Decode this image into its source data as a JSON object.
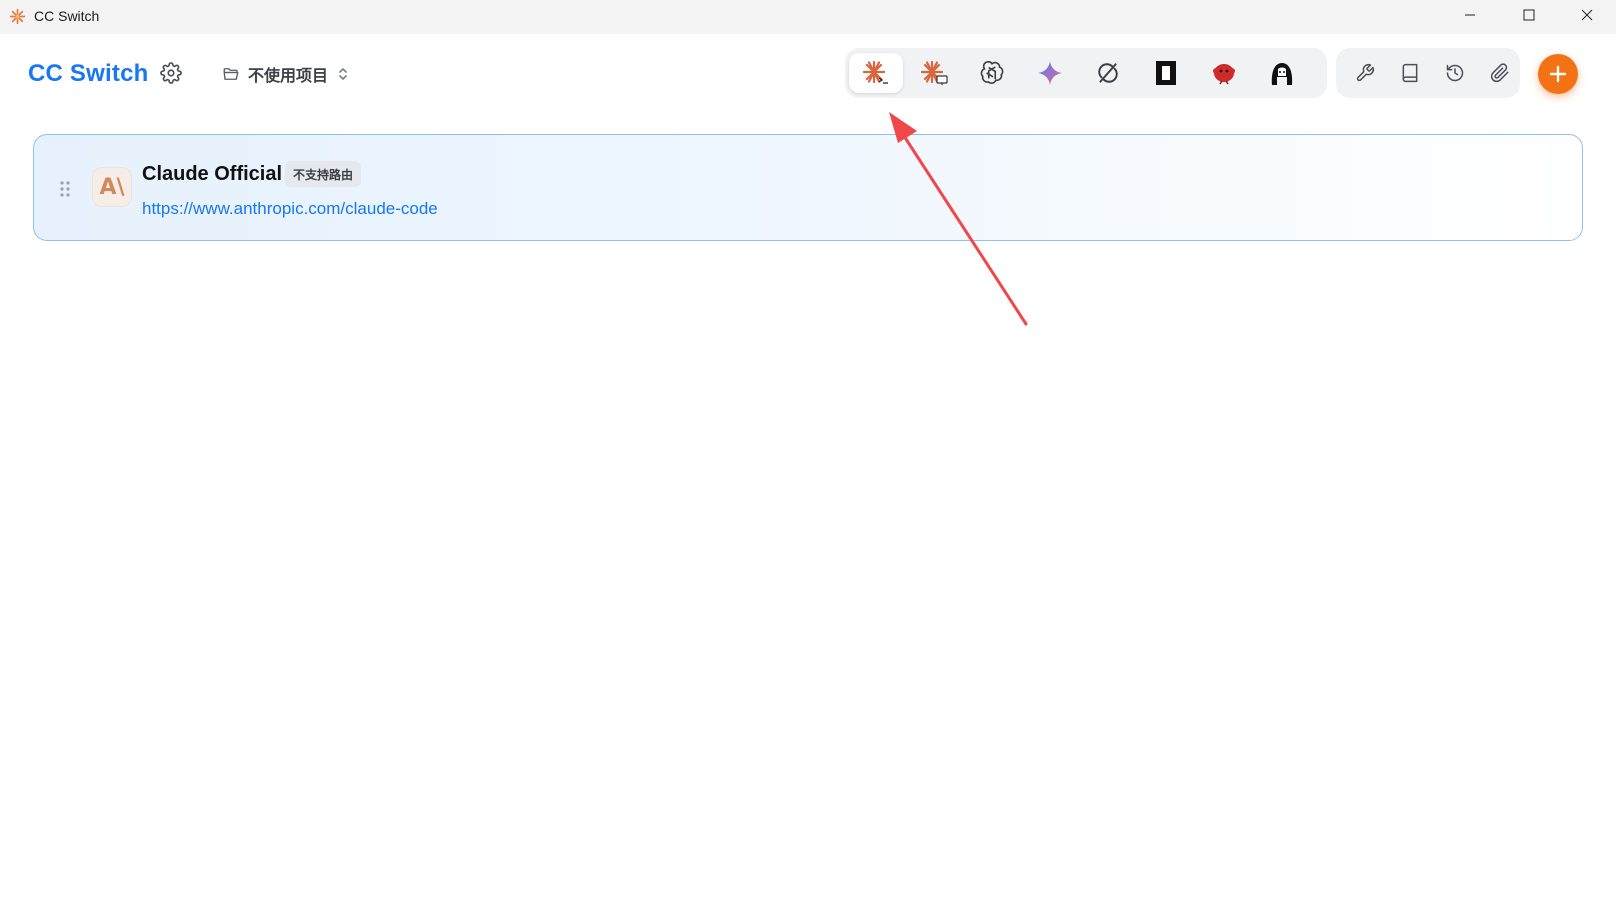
{
  "window": {
    "title": "CC Switch",
    "controls": [
      "minimize",
      "maximize",
      "close"
    ]
  },
  "header": {
    "brand": "CC Switch",
    "settings_icon": "gear-icon",
    "project": {
      "icon": "folder-icon",
      "label": "不使用项目",
      "chevron": "chevron-updown-icon"
    },
    "apps": [
      {
        "name": "claude-code",
        "icon": "claude-terminal-icon",
        "active": true
      },
      {
        "name": "claude-desktop",
        "icon": "claude-desktop-icon",
        "active": false
      },
      {
        "name": "openai",
        "icon": "openai-icon",
        "active": false
      },
      {
        "name": "gemini",
        "icon": "gemini-icon",
        "active": false
      },
      {
        "name": "opencode",
        "icon": "circle-slash-icon",
        "active": false
      },
      {
        "name": "app-6",
        "icon": "black-square-icon",
        "active": false
      },
      {
        "name": "app-7",
        "icon": "red-bird-icon",
        "active": false
      },
      {
        "name": "app-8",
        "icon": "character-icon",
        "active": false
      }
    ],
    "tools": [
      {
        "name": "wrench",
        "icon": "wrench-icon"
      },
      {
        "name": "book",
        "icon": "book-icon"
      },
      {
        "name": "history",
        "icon": "history-icon"
      },
      {
        "name": "paperclip",
        "icon": "paperclip-icon"
      }
    ],
    "add_icon": "plus-icon"
  },
  "providers": [
    {
      "name": "Claude Official",
      "badge": "不支持路由",
      "url": "https://www.anthropic.com/claude-code",
      "logo_text": "A\\"
    }
  ],
  "colors": {
    "brand": "#1877f2",
    "accent": "#f47216",
    "card_border": "#8ec2f5",
    "annotation": "#f0484a"
  }
}
